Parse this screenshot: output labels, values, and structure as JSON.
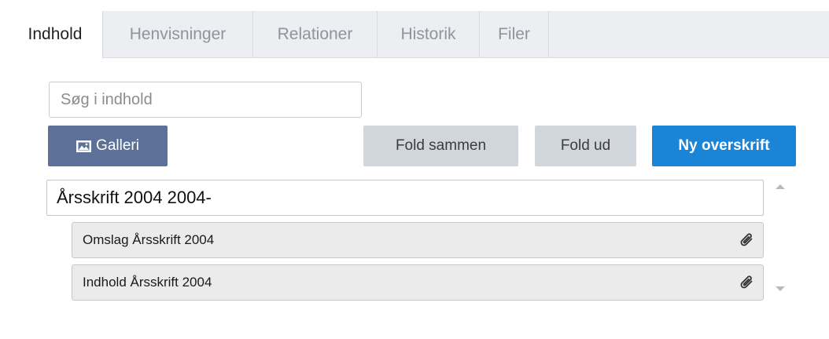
{
  "tabs": [
    {
      "label": "Indhold",
      "active": true
    },
    {
      "label": "Henvisninger",
      "active": false
    },
    {
      "label": "Relationer",
      "active": false
    },
    {
      "label": "Historik",
      "active": false
    },
    {
      "label": "Filer",
      "active": false
    }
  ],
  "search": {
    "placeholder": "Søg i indhold",
    "value": ""
  },
  "toolbar": {
    "gallery_label": "Galleri",
    "fold_collapse_label": "Fold sammen",
    "fold_expand_label": "Fold ud",
    "new_heading_label": "Ny overskrift"
  },
  "tree": {
    "root_label": "Årsskrift 2004 2004-",
    "children": [
      {
        "label": "Omslag Årsskrift 2004",
        "icon": "paperclip-icon"
      },
      {
        "label": "Indhold Årsskrift 2004",
        "icon": "paperclip-icon"
      }
    ]
  },
  "colors": {
    "gallery_button": "#5d7098",
    "primary_button": "#1a84d6",
    "secondary_button": "#d1d6dc",
    "tab_bar": "#eceef1"
  }
}
